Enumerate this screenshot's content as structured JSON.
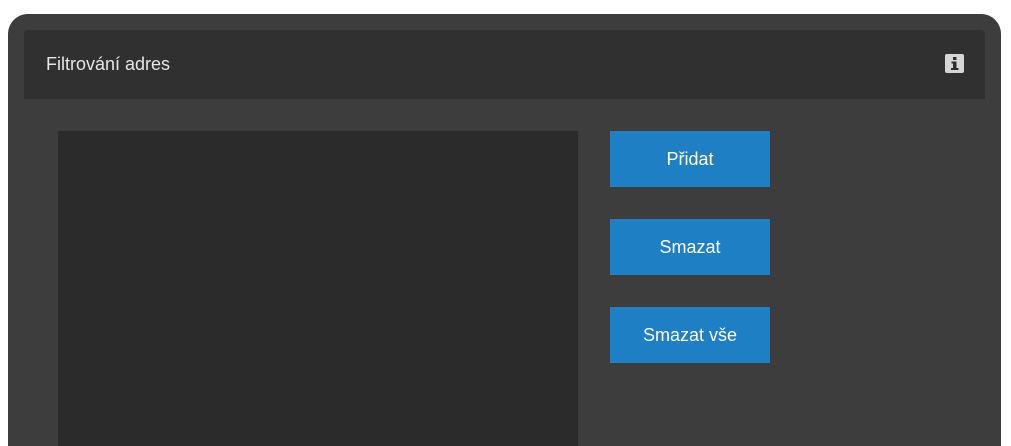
{
  "panel": {
    "title": "Filtrování adres",
    "info_icon": "info-icon"
  },
  "buttons": {
    "add_label": "Přidat",
    "delete_label": "Smazat",
    "delete_all_label": "Smazat vše"
  },
  "colors": {
    "panel_bg": "#3d3d3d",
    "header_bg": "#303030",
    "list_bg": "#2b2b2b",
    "button_accent": "#1e7fc4",
    "text": "#e6e6e6"
  }
}
